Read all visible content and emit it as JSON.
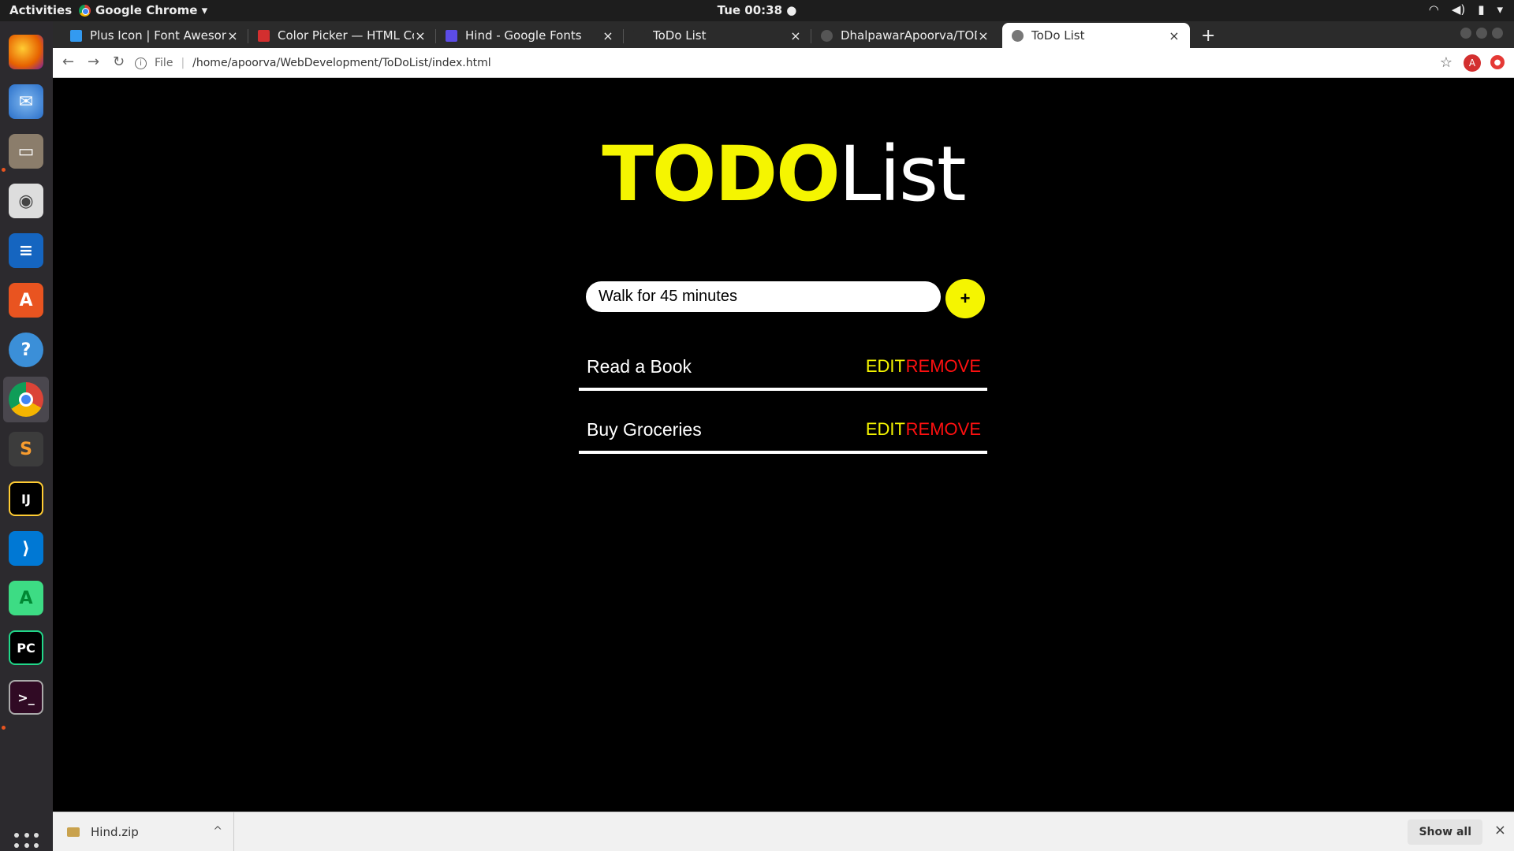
{
  "system": {
    "activities": "Activities",
    "app_menu": "Google Chrome ▾",
    "clock": "Tue 00:38 ●",
    "status_icons": [
      "wifi-icon",
      "volume-icon",
      "battery-icon",
      "menu-arrow-icon"
    ]
  },
  "dock": {
    "apps": [
      {
        "name": "firefox",
        "color": "#e66000"
      },
      {
        "name": "thunderbird",
        "color": "#2a6fc9"
      },
      {
        "name": "files",
        "color": "#8b7d6b"
      },
      {
        "name": "rhythmbox",
        "color": "#e0b000"
      },
      {
        "name": "libreoffice-writer",
        "color": "#1565c0"
      },
      {
        "name": "ubuntu-software",
        "color": "#e95420"
      },
      {
        "name": "help",
        "color": "#3b8fd8"
      },
      {
        "name": "chrome",
        "color": "#4285f4"
      },
      {
        "name": "sublime-text",
        "color": "#f89c2e"
      },
      {
        "name": "intellij",
        "color": "#000000"
      },
      {
        "name": "vscode",
        "color": "#0078d4"
      },
      {
        "name": "android-studio",
        "color": "#3ddc84"
      },
      {
        "name": "pycharm",
        "color": "#21d789"
      },
      {
        "name": "terminal",
        "color": "#300a24"
      }
    ]
  },
  "browser": {
    "tabs": [
      {
        "title": "Plus Icon | Font Awesome",
        "fav_color": "#339af0"
      },
      {
        "title": "Color Picker — HTML Colo",
        "fav_color": "#d32f2f"
      },
      {
        "title": "Hind - Google Fonts",
        "fav_color": "#5c4ce6"
      },
      {
        "title": "ToDo List",
        "fav_color": "#2b2b2b"
      },
      {
        "title": "DhalpawarApoorva/TODO",
        "fav_color": "#222222"
      },
      {
        "title": "ToDo List",
        "fav_color": "#777777"
      }
    ],
    "active_tab_index": 5,
    "new_tab": "+",
    "url_scheme_label": "File",
    "url": "/home/apoorva/WebDevelopment/ToDoList/index.html",
    "profile_initial": "A"
  },
  "app": {
    "title_part1": "TODO",
    "title_part2": "List",
    "input_value": "Walk for 45 minutes",
    "add_label": "+",
    "items": [
      {
        "text": "Read a Book",
        "edit": "EDIT",
        "remove": "REMOVE"
      },
      {
        "text": "Buy Groceries",
        "edit": "EDIT",
        "remove": "REMOVE"
      }
    ],
    "colors": {
      "accent": "#f5f500",
      "remove": "#ff1010",
      "background": "#000000"
    }
  },
  "downloads": {
    "file": "Hind.zip",
    "show_all": "Show all"
  }
}
